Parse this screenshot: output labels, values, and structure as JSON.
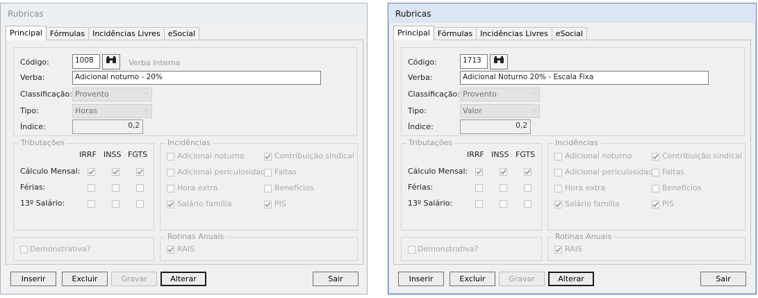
{
  "windows": [
    {
      "title": "Rubricas",
      "tabs": [
        "Principal",
        "Fórmulas",
        "Incidências Livres",
        "eSocial"
      ],
      "form": {
        "codigo_label": "Código:",
        "codigo_value": "1008",
        "verba_interna": "Verba Interna",
        "verba_label": "Verba:",
        "verba_value": "Adicional noturno - 20%",
        "classificacao_label": "Classificação:",
        "classificacao_value": "Provento",
        "tipo_label": "Tipo:",
        "tipo_value": "Horas",
        "indice_label": "Índice:",
        "indice_value": "0,2"
      },
      "tributacoes": {
        "title": "Tributações",
        "cols": [
          "IRRF",
          "INSS",
          "FGTS"
        ],
        "rows": [
          {
            "label": "Cálculo Mensal:",
            "checks": [
              true,
              true,
              true
            ]
          },
          {
            "label": "Férias:",
            "checks": [
              false,
              false,
              false
            ]
          },
          {
            "label": "13º Salário:",
            "checks": [
              false,
              false,
              false
            ]
          }
        ]
      },
      "incidencias": {
        "title": "Incidências",
        "items": [
          {
            "label": "Adicional noturno",
            "checked": false
          },
          {
            "label": "Contribuição sindical",
            "checked": true
          },
          {
            "label": "Adicional periculosidade",
            "checked": false
          },
          {
            "label": "Faltas",
            "checked": false
          },
          {
            "label": "Hora extra",
            "checked": false
          },
          {
            "label": "Benefícios",
            "checked": false
          },
          {
            "label": "Salário família",
            "checked": true
          },
          {
            "label": "PIS",
            "checked": true
          }
        ]
      },
      "demonstrativa": {
        "label": "Demonstrativa?",
        "checked": false
      },
      "rotinas": {
        "title": "Rotinas Anuais",
        "rais_label": "RAIS",
        "rais_checked": true
      },
      "buttons": {
        "inserir": "Inserir",
        "excluir": "Excluir",
        "gravar": "Gravar",
        "alterar": "Alterar",
        "sair": "Sair"
      }
    },
    {
      "title": "Rubricas",
      "tabs": [
        "Principal",
        "Fórmulas",
        "Incidências Livres",
        "eSocial"
      ],
      "form": {
        "codigo_label": "Código:",
        "codigo_value": "1713",
        "verba_interna": "",
        "verba_label": "Verba:",
        "verba_value": "Adicional Noturno 20% - Escala Fixa",
        "classificacao_label": "Classificação:",
        "classificacao_value": "Provento",
        "tipo_label": "Tipo:",
        "tipo_value": "Valor",
        "indice_label": "Índice:",
        "indice_value": "0,2"
      },
      "tributacoes": {
        "title": "Tributações",
        "cols": [
          "IRRF",
          "INSS",
          "FGTS"
        ],
        "rows": [
          {
            "label": "Cálculo Mensal:",
            "checks": [
              true,
              true,
              true
            ]
          },
          {
            "label": "Férias:",
            "checks": [
              false,
              false,
              false
            ]
          },
          {
            "label": "13º Salário:",
            "checks": [
              false,
              false,
              false
            ]
          }
        ]
      },
      "incidencias": {
        "title": "Incidências",
        "items": [
          {
            "label": "Adicional noturno",
            "checked": false
          },
          {
            "label": "Contribuição sindical",
            "checked": true
          },
          {
            "label": "Adicional periculosidade",
            "checked": false
          },
          {
            "label": "Faltas",
            "checked": false
          },
          {
            "label": "Hora extra",
            "checked": false
          },
          {
            "label": "Benefícios",
            "checked": false
          },
          {
            "label": "Salário família",
            "checked": true
          },
          {
            "label": "PIS",
            "checked": true
          }
        ]
      },
      "demonstrativa": {
        "label": "Demonstrativa?",
        "checked": false
      },
      "rotinas": {
        "title": "Rotinas Anuais",
        "rais_label": "RAIS",
        "rais_checked": true
      },
      "buttons": {
        "inserir": "Inserir",
        "excluir": "Excluir",
        "gravar": "Gravar",
        "alterar": "Alterar",
        "sair": "Sair"
      }
    }
  ],
  "icons": {
    "search": "binoculars-icon",
    "dropdown": "chevron-down-icon",
    "check": "checkmark-icon"
  }
}
